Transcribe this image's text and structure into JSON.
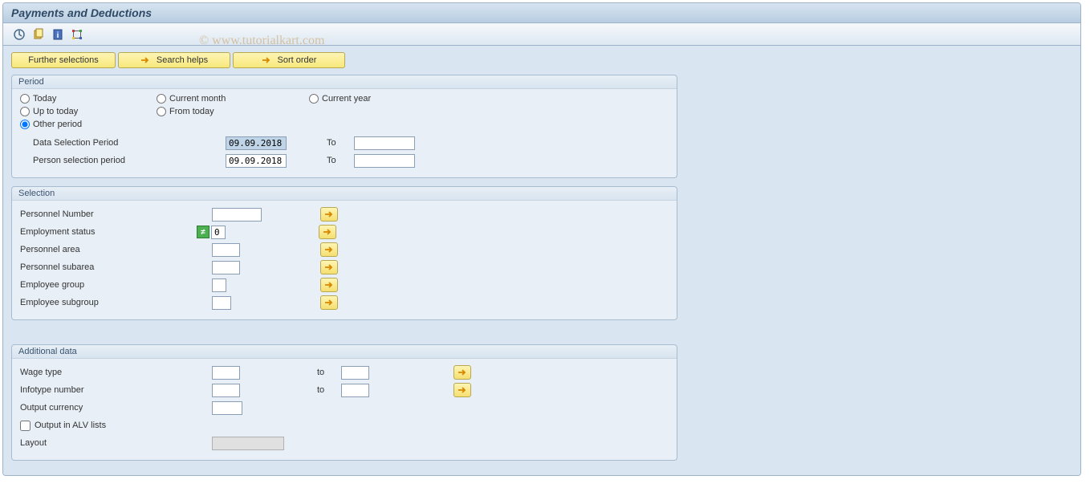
{
  "title": "Payments and Deductions",
  "watermark": "© www.tutorialkart.com",
  "toolbar_buttons": {
    "further_selections": "Further selections",
    "search_helps": "Search helps",
    "sort_order": "Sort order"
  },
  "period": {
    "group_label": "Period",
    "radios": {
      "today": "Today",
      "current_month": "Current month",
      "current_year": "Current year",
      "up_to_today": "Up to today",
      "from_today": "From today",
      "other_period": "Other period"
    },
    "selected": "other_period",
    "data_selection_label": "Data Selection Period",
    "data_selection_from": "09.09.2018",
    "data_selection_to": "",
    "person_selection_label": "Person selection period",
    "person_selection_from": "09.09.2018",
    "person_selection_to": "",
    "to_label": "To"
  },
  "selection": {
    "group_label": "Selection",
    "personnel_number_label": "Personnel Number",
    "personnel_number": "",
    "employment_status_label": "Employment status",
    "employment_status": "0",
    "personnel_area_label": "Personnel area",
    "personnel_area": "",
    "personnel_subarea_label": "Personnel subarea",
    "personnel_subarea": "",
    "employee_group_label": "Employee group",
    "employee_group": "",
    "employee_subgroup_label": "Employee subgroup",
    "employee_subgroup": ""
  },
  "additional": {
    "group_label": "Additional data",
    "wage_type_label": "Wage type",
    "wage_type_from": "",
    "wage_type_to": "",
    "infotype_label": "Infotype number",
    "infotype_from": "",
    "infotype_to": "",
    "output_currency_label": "Output currency",
    "output_currency": "",
    "alv_label": "Output in ALV lists",
    "alv_checked": false,
    "layout_label": "Layout",
    "layout": "",
    "to_label": "to"
  }
}
